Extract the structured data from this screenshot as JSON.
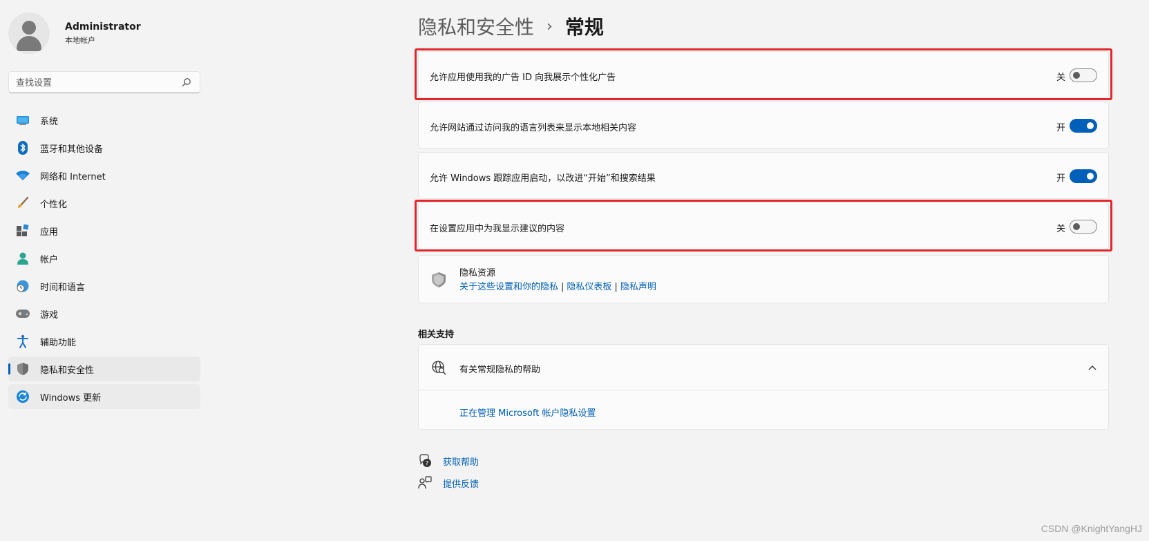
{
  "user": {
    "name": "Administrator",
    "account_type": "本地帐户"
  },
  "search": {
    "placeholder": "查找设置"
  },
  "sidebar": {
    "items": [
      {
        "label": "系统",
        "icon": "system-icon"
      },
      {
        "label": "蓝牙和其他设备",
        "icon": "bluetooth-icon"
      },
      {
        "label": "网络和 Internet",
        "icon": "wifi-icon"
      },
      {
        "label": "个性化",
        "icon": "brush-icon"
      },
      {
        "label": "应用",
        "icon": "apps-icon"
      },
      {
        "label": "帐户",
        "icon": "account-icon"
      },
      {
        "label": "时间和语言",
        "icon": "time-language-icon"
      },
      {
        "label": "游戏",
        "icon": "gamepad-icon"
      },
      {
        "label": "辅助功能",
        "icon": "accessibility-icon"
      },
      {
        "label": "隐私和安全性",
        "icon": "shield-icon",
        "selected": true
      },
      {
        "label": "Windows 更新",
        "icon": "windows-update-icon"
      }
    ]
  },
  "breadcrumb": {
    "parent": "隐私和安全性",
    "separator": "›",
    "current": "常规"
  },
  "settings": [
    {
      "label": "允许应用使用我的广告 ID 向我展示个性化广告",
      "state_label": "关",
      "on": false,
      "highlighted": true
    },
    {
      "label": "允许网站通过访问我的语言列表来显示本地相关内容",
      "state_label": "开",
      "on": true,
      "highlighted": false
    },
    {
      "label": "允许 Windows 跟踪应用启动，以改进“开始”和搜索结果",
      "state_label": "开",
      "on": true,
      "highlighted": false
    },
    {
      "label": "在设置应用中为我显示建议的内容",
      "state_label": "关",
      "on": false,
      "highlighted": true
    }
  ],
  "privacy_resources": {
    "title": "隐私资源",
    "links": [
      "关于这些设置和你的隐私",
      "隐私仪表板",
      "隐私声明"
    ],
    "separator": "|"
  },
  "related_support": {
    "title": "相关支持",
    "help_title": "有关常规隐私的帮助",
    "help_link": "正在管理 Microsoft 帐户隐私设置"
  },
  "bottom_links": {
    "get_help": "获取帮助",
    "feedback": "提供反馈"
  },
  "watermark": "CSDN @KnightYangHJ",
  "colors": {
    "accent": "#005fb8",
    "highlight_border": "#e1262c",
    "background": "#f3f3f3"
  }
}
